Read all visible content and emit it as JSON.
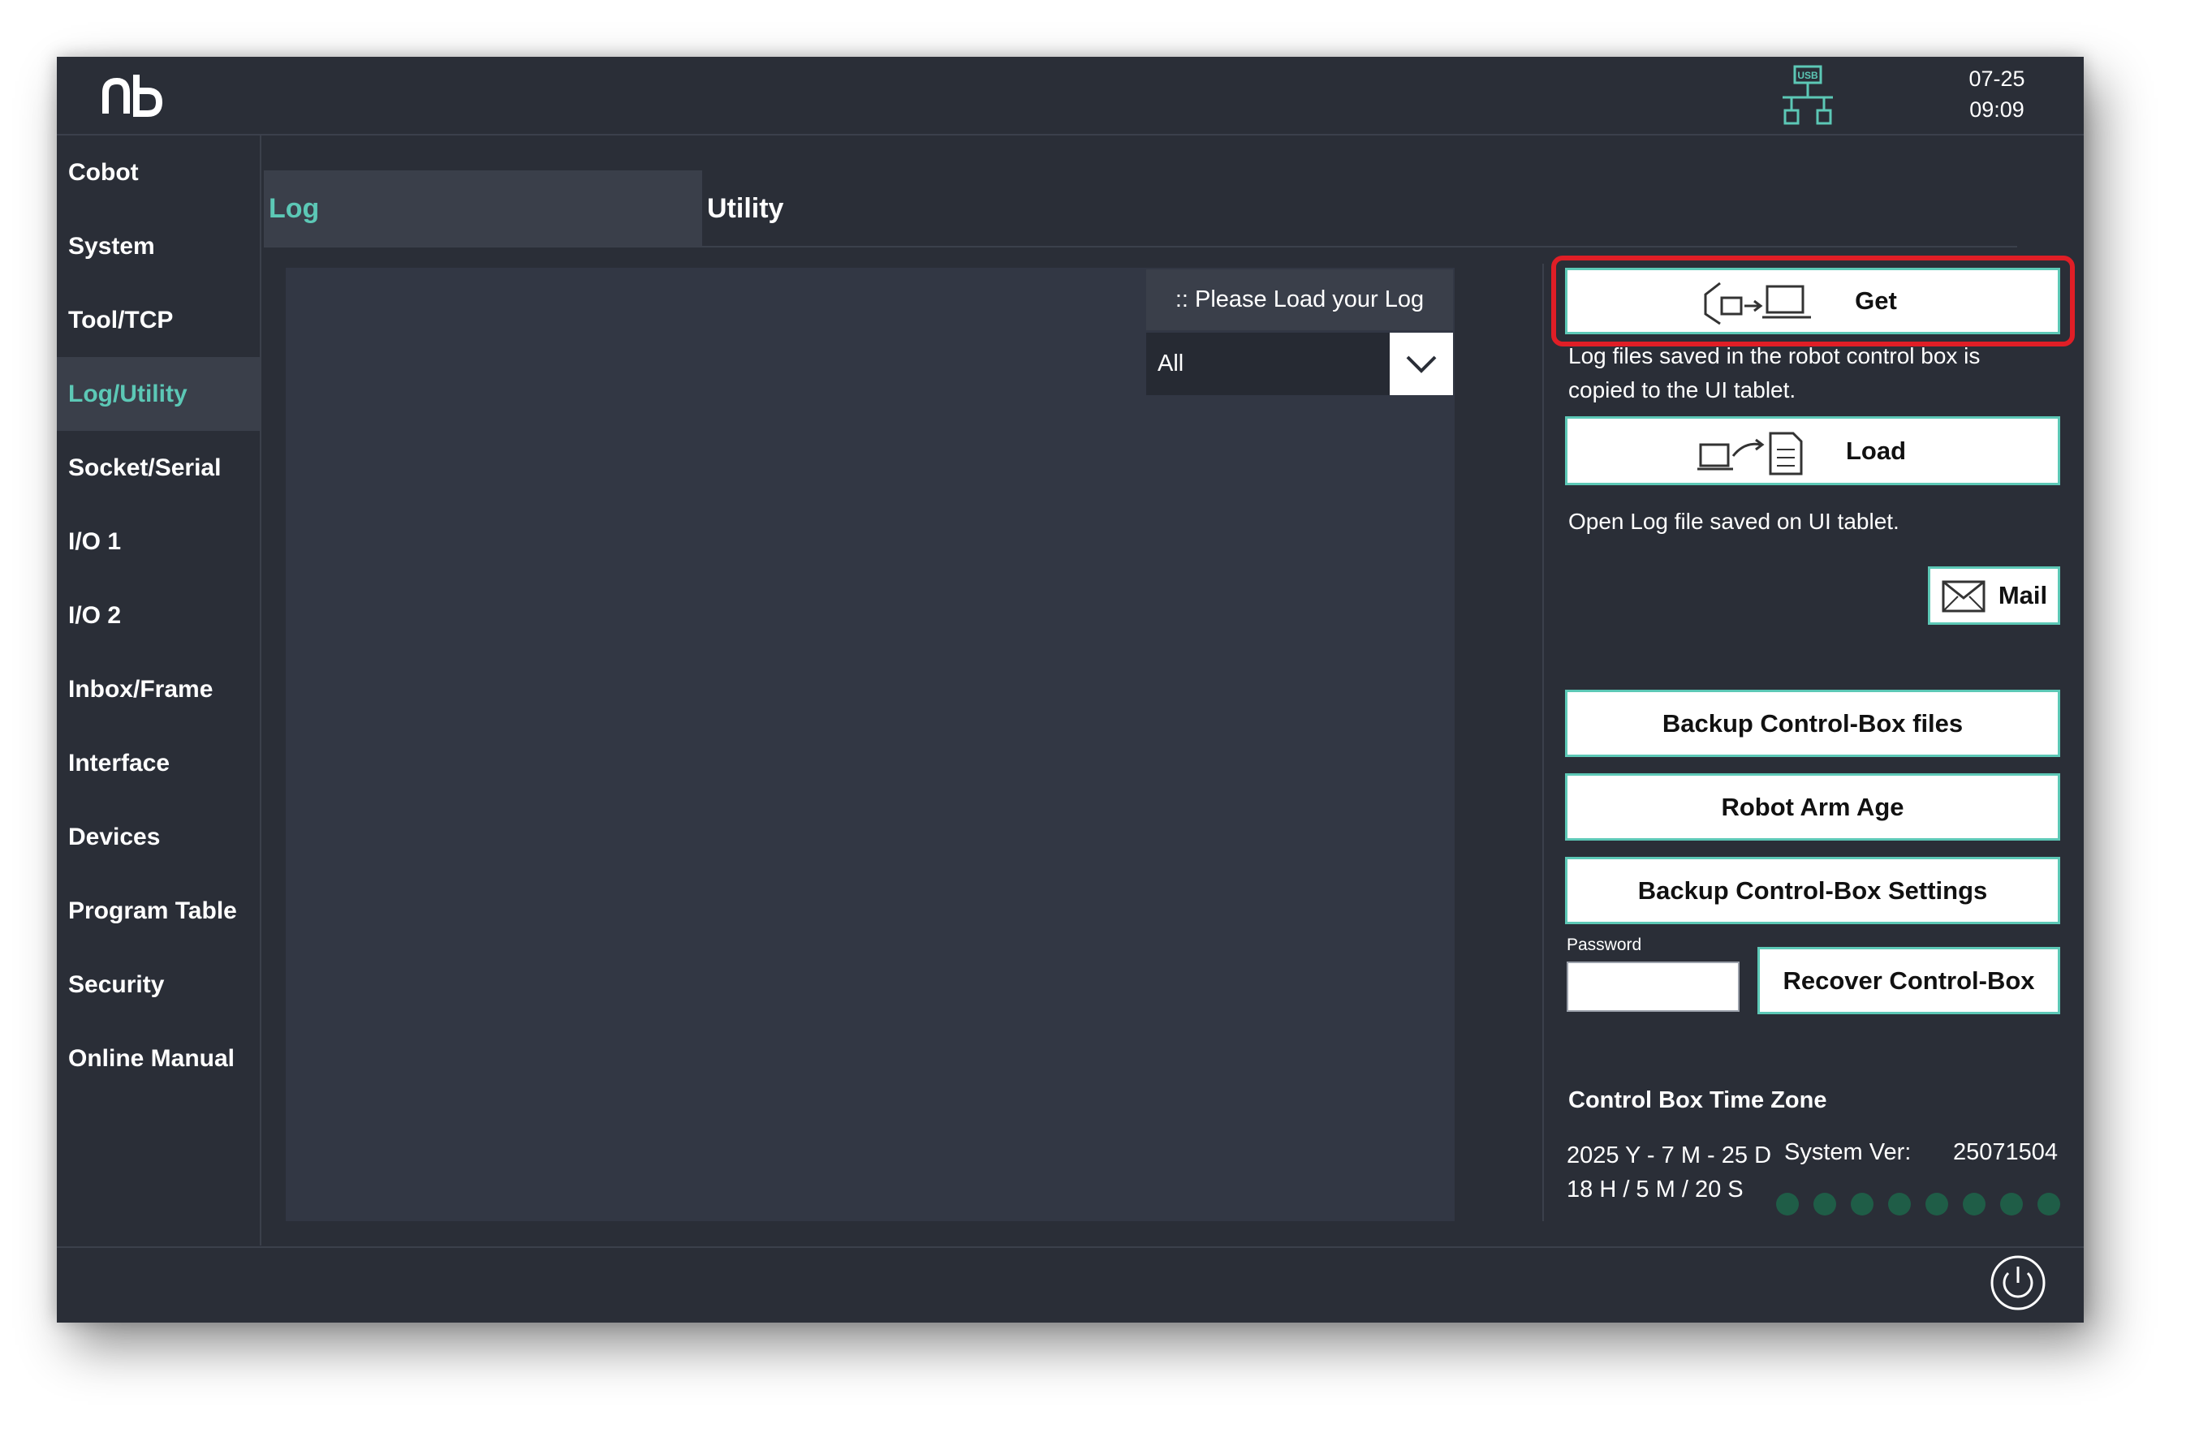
{
  "header": {
    "logo_text": "rb",
    "usb_label": "USB",
    "date": "07-25",
    "time": "09:09"
  },
  "sidebar": {
    "items": [
      {
        "label": "Cobot",
        "active": false
      },
      {
        "label": "System",
        "active": false
      },
      {
        "label": "Tool/TCP",
        "active": false
      },
      {
        "label": "Log/Utility",
        "active": true
      },
      {
        "label": "Socket/Serial",
        "active": false
      },
      {
        "label": "I/O 1",
        "active": false
      },
      {
        "label": "I/O 2",
        "active": false
      },
      {
        "label": "Inbox/Frame",
        "active": false
      },
      {
        "label": "Interface",
        "active": false
      },
      {
        "label": "Devices",
        "active": false
      },
      {
        "label": "Program Table",
        "active": false
      },
      {
        "label": "Security",
        "active": false
      },
      {
        "label": "Online Manual",
        "active": false
      }
    ]
  },
  "tabs": [
    {
      "label": "Log",
      "active": true
    },
    {
      "label": "Utility",
      "active": false
    }
  ],
  "log": {
    "hint": ":: Please Load your Log",
    "filter_value": "All"
  },
  "actions": {
    "get_label": "Get",
    "get_desc_line1": "Log files saved in the robot control box is",
    "get_desc_line2": "copied to the UI tablet.",
    "load_label": "Load",
    "load_desc": "Open Log file saved on UI tablet.",
    "mail_label": "Mail",
    "backup_files_label": "Backup Control-Box files",
    "robot_arm_age_label": "Robot Arm Age",
    "backup_settings_label": "Backup Control-Box Settings",
    "password_label": "Password",
    "password_value": "",
    "recover_label": "Recover Control-Box"
  },
  "timezone": {
    "title": "Control Box Time Zone",
    "date_line": "2025 Y - 7 M - 25 D",
    "time_line": "18 H / 5 M / 20 S",
    "system_ver_label": "System Ver:",
    "system_ver_value": "25071504",
    "status_dot_count": 8
  },
  "colors": {
    "accent": "#5cc8b6",
    "highlight": "#e01e26",
    "background": "#2a2e37",
    "status_dot": "#1f5d47"
  }
}
